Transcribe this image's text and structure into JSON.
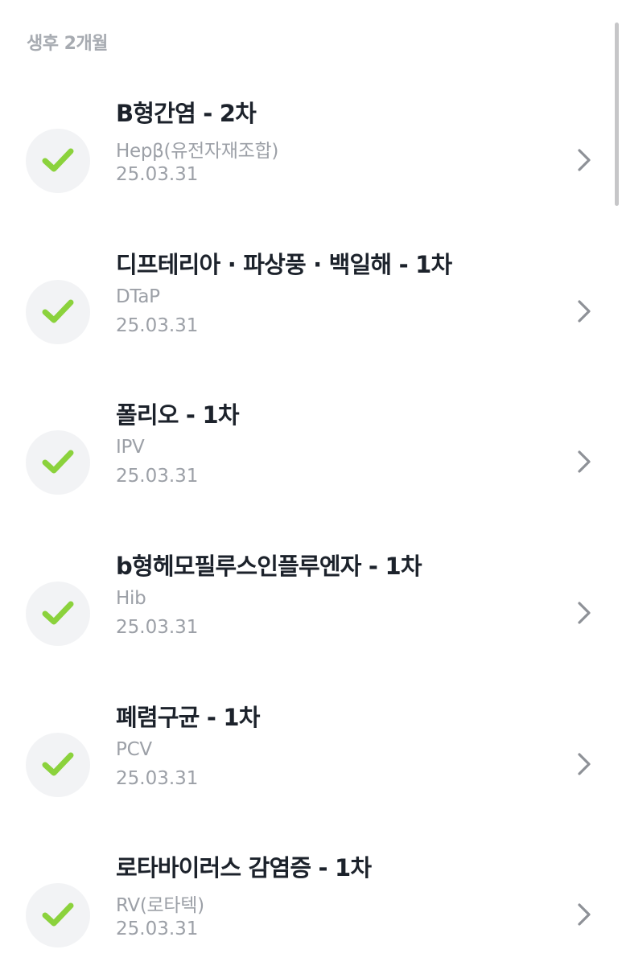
{
  "section": {
    "header": "생후 2개월"
  },
  "colors": {
    "check": "#8bd23c",
    "check_bg": "#f2f3f5",
    "title": "#1c222b",
    "muted": "#9ca0a7",
    "chevron": "#8e9197"
  },
  "icons": {
    "status": "checkmark-icon",
    "row_action": "chevron-right-icon"
  },
  "vaccines": [
    {
      "title": "B형간염 - 2차",
      "subtitle": "Hepβ(유전자재조합)",
      "date": "25.03.31"
    },
    {
      "title": "디프테리아 · 파상풍 · 백일해 - 1차",
      "subtitle": "DTaP",
      "date": "25.03.31"
    },
    {
      "title": "폴리오 - 1차",
      "subtitle": "IPV",
      "date": "25.03.31"
    },
    {
      "title": "b형헤모필루스인플루엔자 - 1차",
      "subtitle": "Hib",
      "date": "25.03.31"
    },
    {
      "title": "폐렴구균 - 1차",
      "subtitle": "PCV",
      "date": "25.03.31"
    },
    {
      "title": "로타바이러스 감염증 - 1차",
      "subtitle": "RV(로타텍)",
      "date": "25.03.31"
    }
  ]
}
